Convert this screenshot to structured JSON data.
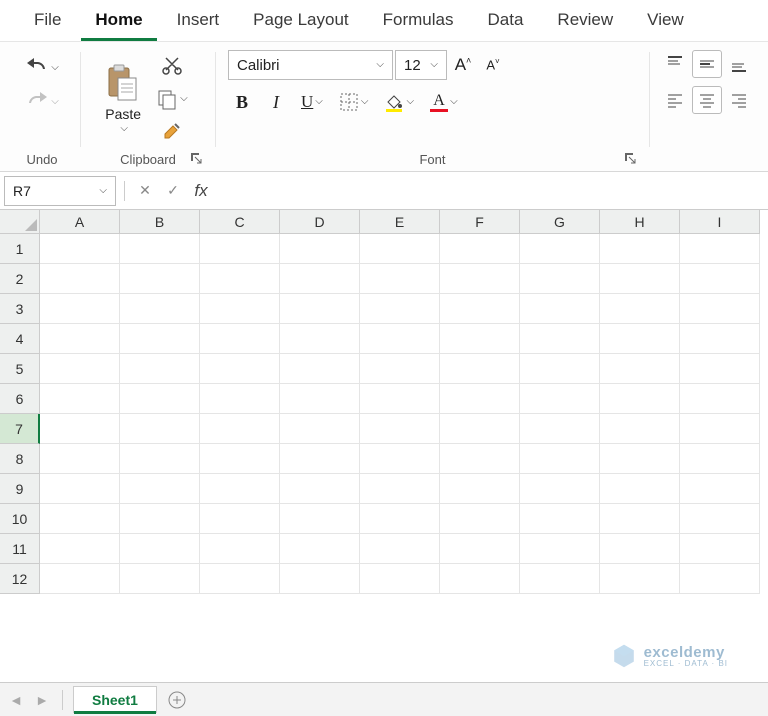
{
  "tabs": {
    "file": "File",
    "home": "Home",
    "insert": "Insert",
    "pagelayout": "Page Layout",
    "formulas": "Formulas",
    "data": "Data",
    "review": "Review",
    "view": "View"
  },
  "ribbon": {
    "undo": {
      "label": "Undo"
    },
    "clipboard": {
      "label": "Clipboard",
      "paste": "Paste"
    },
    "font": {
      "label": "Font",
      "name": "Calibri",
      "size": "12",
      "bold": "B",
      "italic": "I",
      "underline": "U",
      "increase_sup": "˄",
      "decrease_sup": "˅",
      "letter_a": "A"
    }
  },
  "formula_bar": {
    "name_box": "R7",
    "fx": "fx",
    "value": ""
  },
  "grid": {
    "columns": [
      "A",
      "B",
      "C",
      "D",
      "E",
      "F",
      "G",
      "H",
      "I"
    ],
    "rows": [
      "1",
      "2",
      "3",
      "4",
      "5",
      "6",
      "7",
      "8",
      "9",
      "10",
      "11",
      "12"
    ],
    "selected_row": 7
  },
  "sheets": {
    "active": "Sheet1"
  },
  "watermark": {
    "name": "exceldemy",
    "tagline": "EXCEL · DATA · BI"
  }
}
